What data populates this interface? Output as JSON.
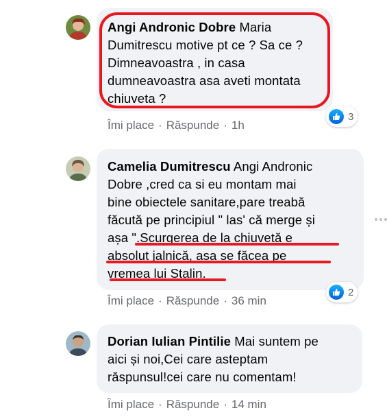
{
  "comments": [
    {
      "author": "Angi Andronic Dobre",
      "lines": [
        " Maria",
        "Dumitrescu motive pt ce ? Sa ce ?",
        "Dimneavoastra , in casa",
        "dumneavoastra asa aveti montata",
        "chiuveta ?"
      ],
      "like_label": "Îmi place",
      "reply_label": "Răspunde",
      "time": "1h",
      "reaction_count": "3"
    },
    {
      "author": "Camelia Dumitrescu",
      "lines": [
        " Angi Andronic",
        "Dobre ,cred ca si eu montam mai",
        "bine obiectele sanitare,pare treabă",
        "făcută pe principiul \" las' că merge și",
        "așa \".Scurgerea de la chiuvetă e",
        "absolut jalnică, asa se făcea pe",
        "vremea lui Stalin."
      ],
      "like_label": "Îmi place",
      "reply_label": "Răspunde",
      "time": "36 min",
      "reaction_count": "2"
    },
    {
      "author": "Dorian Iulian Pintilie",
      "lines": [
        " Mai suntem pe",
        "aici și noi,Cei care asteptam",
        "răspunsul!cei care nu comentam!"
      ],
      "like_label": "Îmi place",
      "reply_label": "Răspunde",
      "time": "14 min"
    }
  ],
  "separator": "·",
  "colors": {
    "bubble": "#f0f2f5",
    "meta_text": "#65676b",
    "annotation_red": "#e41b23",
    "like_blue": "#1877f2"
  }
}
